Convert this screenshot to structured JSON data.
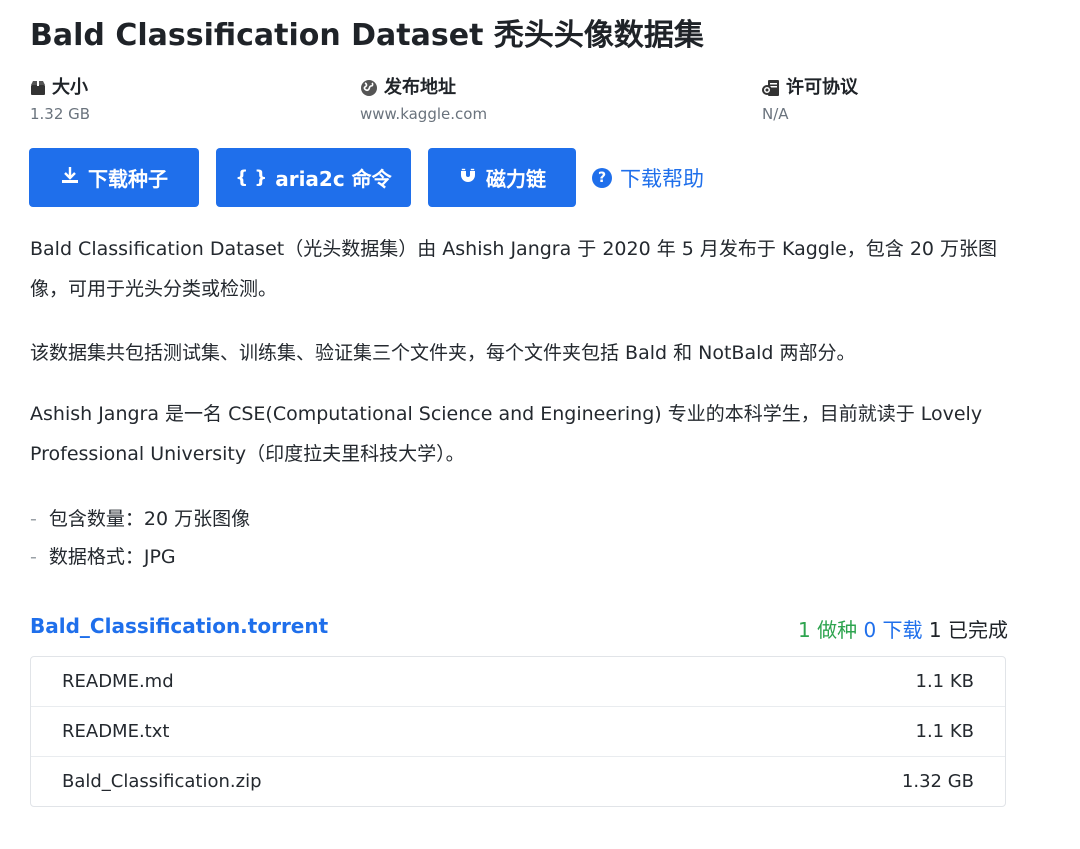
{
  "title": "Bald Classification Dataset 秃头头像数据集",
  "meta": {
    "size": {
      "label": "大小",
      "value": "1.32 GB",
      "icon": "package-icon"
    },
    "source": {
      "label": "发布地址",
      "value": "www.kaggle.com",
      "icon": "globe-icon"
    },
    "license": {
      "label": "许可协议",
      "value": "N/A",
      "icon": "license-icon"
    }
  },
  "actions": {
    "download_torrent": "下载种子",
    "aria2c": "aria2c 命令",
    "magnet": "磁力链",
    "help": "下载帮助"
  },
  "description": {
    "p1": "Bald Classification Dataset（光头数据集）由 Ashish Jangra 于 2020 年 5 月发布于 Kaggle，包含 20 万张图像，可用于光头分类或检测。",
    "p2": "该数据集共包括测试集、训练集、验证集三个文件夹，每个文件夹包括 Bald 和 NotBald 两部分。",
    "p3": "Ashish Jangra 是一名 CSE(Computational Science and Engineering) 专业的本科学生，目前就读于 Lovely Professional University（印度拉夫里科技大学）。"
  },
  "bullets": [
    "包含数量：20 万张图像",
    "数据格式：JPG"
  ],
  "torrent": {
    "name": "Bald_Classification.torrent",
    "seeders": "1",
    "seeders_label": "做种",
    "leechers": "0",
    "leechers_label": "下载",
    "completed": "1",
    "completed_label": "已完成",
    "files": [
      {
        "name": "README.md",
        "size": "1.1 KB"
      },
      {
        "name": "README.txt",
        "size": "1.1 KB"
      },
      {
        "name": "Bald_Classification.zip",
        "size": "1.32 GB"
      }
    ]
  },
  "colors": {
    "accent": "#1f6feb",
    "seed": "#2ea44f"
  }
}
